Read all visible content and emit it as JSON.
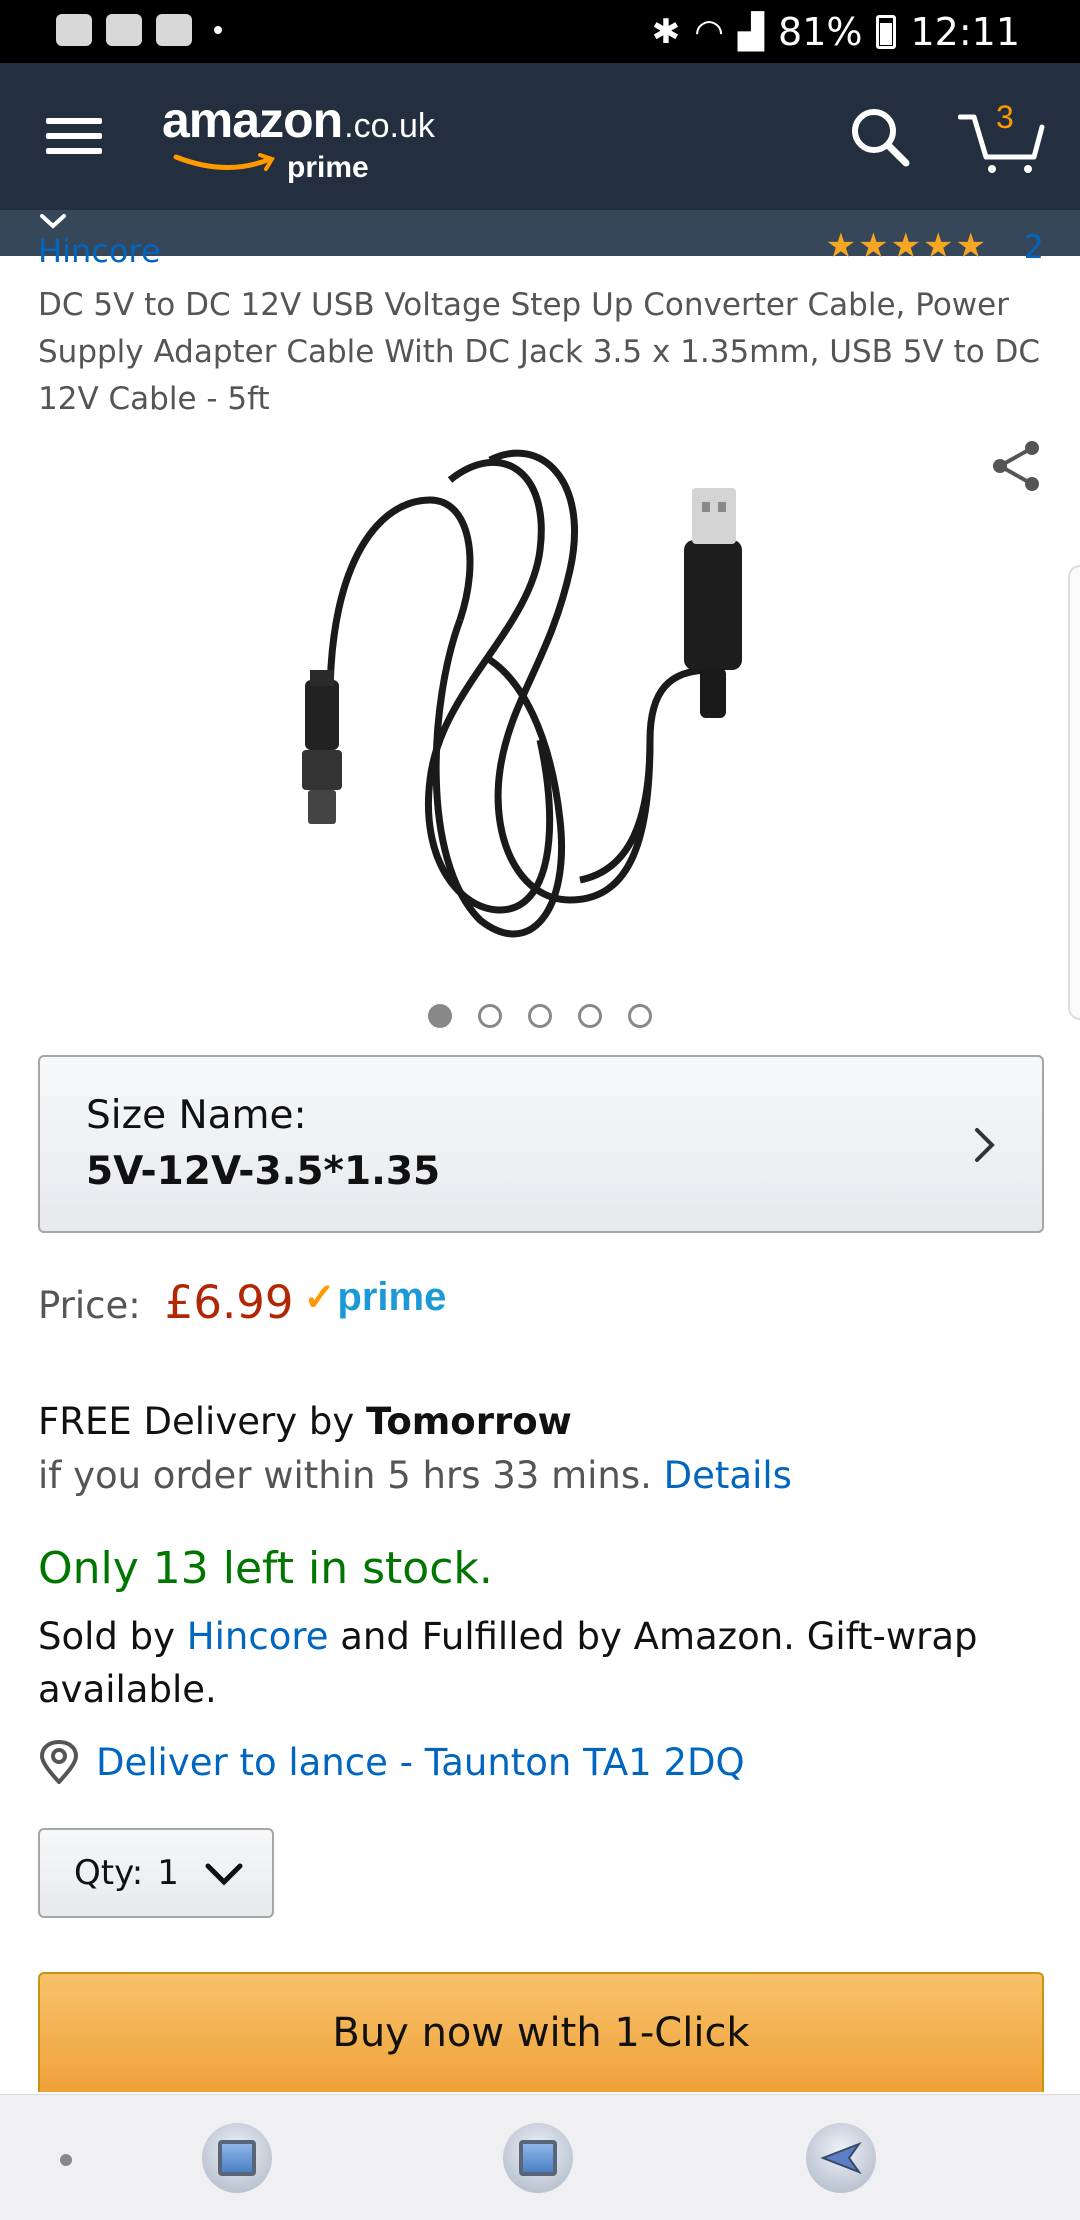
{
  "status_bar": {
    "battery": "81%",
    "time": "12:11"
  },
  "header": {
    "logo_main": "amazon",
    "logo_tld": ".co.uk",
    "logo_prime": "prime",
    "cart_count": "3"
  },
  "product": {
    "brand": "Hincore",
    "rating_count": "2",
    "rating_stars": 5,
    "title": "DC 5V to DC 12V USB Voltage Step Up Converter Cable, Power Supply Adapter Cable With DC Jack 3.5 x 1.35mm, USB 5V to DC 12V Cable - 5ft",
    "image_count": 5,
    "active_image": 1
  },
  "size": {
    "label": "Size Name:",
    "value": "5V-12V-3.5*1.35"
  },
  "price": {
    "label": "Price:",
    "value": "£6.99",
    "prime_label": "prime"
  },
  "delivery": {
    "line1_prefix": "FREE Delivery by ",
    "line1_day": "Tomorrow",
    "line2_prefix": "if you order within 5 hrs 33 mins. ",
    "details_link": "Details"
  },
  "stock": "Only 13 left in stock.",
  "seller": {
    "prefix": "Sold by ",
    "name": "Hincore",
    "suffix": " and Fulfilled by Amazon. Gift-wrap available."
  },
  "deliver_to": "Deliver to lance - Taunton TA1 2DQ",
  "quantity": {
    "label": "Qty:",
    "value": "1"
  },
  "buy_button": "Buy now with 1-Click",
  "colors": {
    "header_bg": "#232f3e",
    "price": "#b12704",
    "stock": "#007600",
    "link": "#0066c0",
    "buy_button": "#f0a13a"
  }
}
